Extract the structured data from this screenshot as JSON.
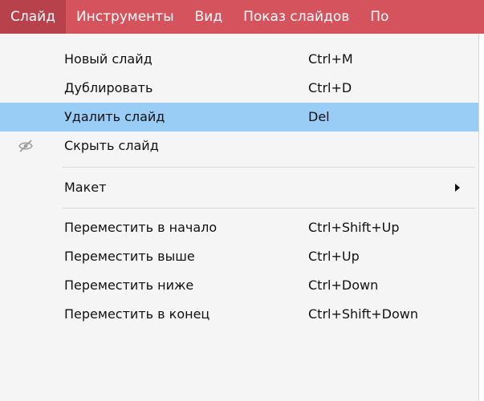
{
  "menubar": {
    "items": [
      {
        "label": "Слайд"
      },
      {
        "label": "Инструменты"
      },
      {
        "label": "Вид"
      },
      {
        "label": "Показ слайдов"
      },
      {
        "label": "По"
      }
    ]
  },
  "menu": {
    "items": [
      {
        "label": "Новый слайд",
        "shortcut": "Ctrl+M"
      },
      {
        "label": "Дублировать",
        "shortcut": "Ctrl+D"
      },
      {
        "label": "Удалить слайд",
        "shortcut": "Del"
      },
      {
        "label": "Скрыть слайд",
        "icon": "hidden-eye-icon"
      },
      {
        "label": "Макет",
        "icon": "submenu-arrow-icon"
      },
      {
        "label": "Переместить в начало",
        "shortcut": "Ctrl+Shift+Up"
      },
      {
        "label": "Переместить выше",
        "shortcut": "Ctrl+Up"
      },
      {
        "label": "Переместить ниже",
        "shortcut": "Ctrl+Down"
      },
      {
        "label": "Переместить в конец",
        "shortcut": "Ctrl+Shift+Down"
      }
    ]
  },
  "colors": {
    "menubar_bg": "#d4535c",
    "menubar_active_bg": "#b8424c",
    "highlight_bg": "#99cdf5",
    "menu_bg": "#f5f5f5"
  }
}
